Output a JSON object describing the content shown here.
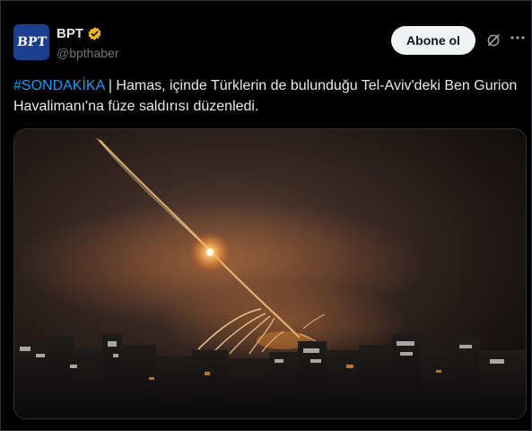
{
  "account": {
    "avatar_text": "BPT",
    "display_name": "BPT",
    "handle": "@bpthaber",
    "verified_badge": "gold-verified-badge"
  },
  "actions": {
    "follow_label": "Abone ol",
    "grok_icon": "grok-icon",
    "more_icon": "more-icon"
  },
  "tweet": {
    "hashtag": "#SONDAKİKA",
    "text": " | Hamas, içinde Türklerin de bulunduğu Tel-Aviv'deki Ben Gurion Havalimanı'na füze saldırısı düzenledi."
  },
  "colors": {
    "background": "#000000",
    "text": "#e7e9ea",
    "muted": "#71767b",
    "link": "#1d9bf0",
    "button_bg": "#eff3f4",
    "verified_gold": "#e8b829",
    "avatar_bg": "#1b3f8f"
  }
}
